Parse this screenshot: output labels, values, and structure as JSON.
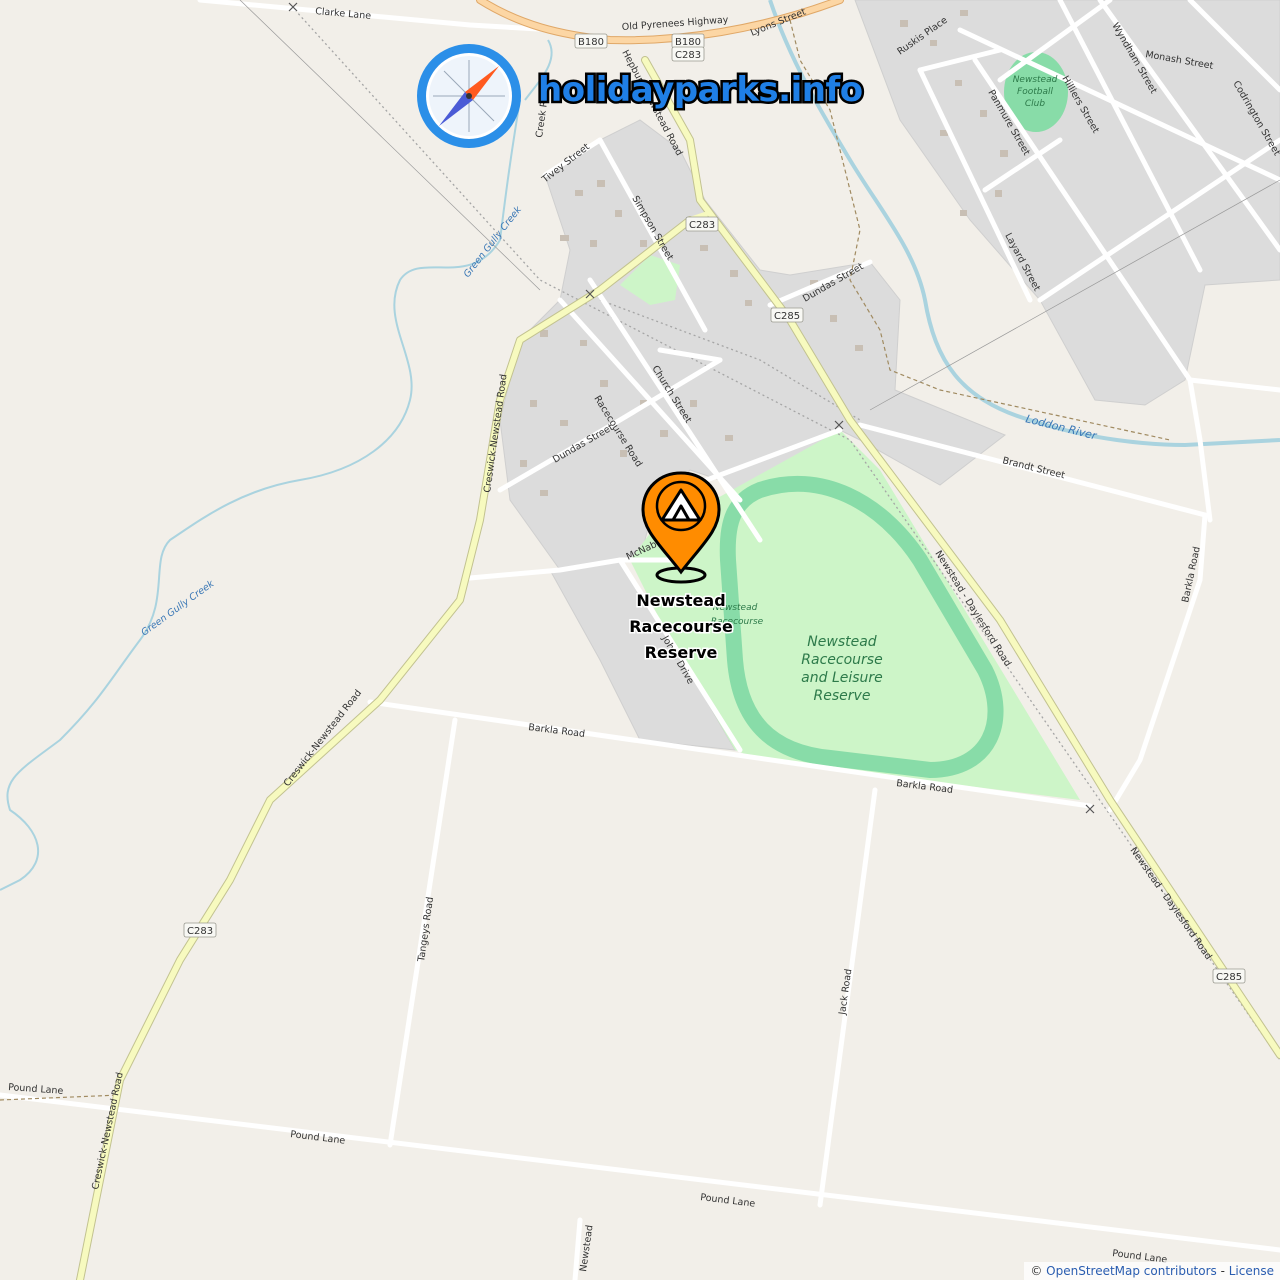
{
  "brand": {
    "title": "holidayparks.info",
    "icon": "compass-icon",
    "colors": {
      "ring": "#2b8fe8",
      "needle_north": "#ff5a1f",
      "needle_south": "#4a5bd6"
    }
  },
  "marker": {
    "icon": "campsite-pin-icon",
    "label_lines": [
      "Newstead",
      "Racecourse",
      "Reserve"
    ],
    "color": "#ff8c00"
  },
  "parks": {
    "racecourse": [
      "Newstead",
      "Racecourse",
      "and Leisure",
      "Reserve"
    ],
    "racecourse_small": [
      "Newstead",
      "Racecourse"
    ],
    "football": [
      "Newstead",
      "Football",
      "Club"
    ]
  },
  "water": {
    "loddon": "Loddon River",
    "green_gully_1": "Green Gully Creek",
    "green_gully_2": "Green Gully Creek"
  },
  "roads": {
    "clarke": "Clarke Lane",
    "old_pyrenees": "Old Pyrenees Highway",
    "lyons": "Lyons Street",
    "creek_r": "Creek R",
    "tivey": "Tivey Street",
    "simpson": "Simpson Street",
    "hepburn": "Hepburn-Newstead Road",
    "dundas_ne": "Dundas Street",
    "dundas_sw": "Dundas Street",
    "church": "Church Street",
    "racecourse_rd": "Racecourse Road",
    "mcnab": "McNab",
    "johns": "Johns Drive",
    "creswick_1": "Creswick-Newstead Road",
    "creswick_2": "Creswick-Newstead Road",
    "creswick_3": "Creswick-Newstead Road",
    "barkla_1": "Barkla Road",
    "barkla_2": "Barkla Road",
    "barkla_3": "Barkla Road",
    "brandt": "Brandt Street",
    "newstead_daylesford_1": "Newstead - Daylesford Road",
    "newstead_daylesford_2": "Newstead - Daylesford Road",
    "tangeys": "Tangeys Road",
    "jack": "Jack Road",
    "pound_1": "Pound Lane",
    "pound_2": "Pound Lane",
    "pound_3": "Pound Lane",
    "pound_4": "Pound Lane",
    "newstead_s": "Newstead",
    "ruskis": "Ruskis Place",
    "panmure": "Panmure Street",
    "hilliers": "Hilliers Street",
    "wyndham": "Wyndham Street",
    "monash": "Monash Street",
    "codrington": "Codrington Street",
    "layard": "Layard Street"
  },
  "shields": {
    "b180a": "B180",
    "b180b": "B180",
    "c283a": "C283",
    "c283b": "C283",
    "c283c": "C283",
    "c285a": "C285",
    "c285b": "C285"
  },
  "attribution": {
    "prefix": "© ",
    "osm": "OpenStreetMap contributors",
    "sep": " - ",
    "license": "License"
  }
}
